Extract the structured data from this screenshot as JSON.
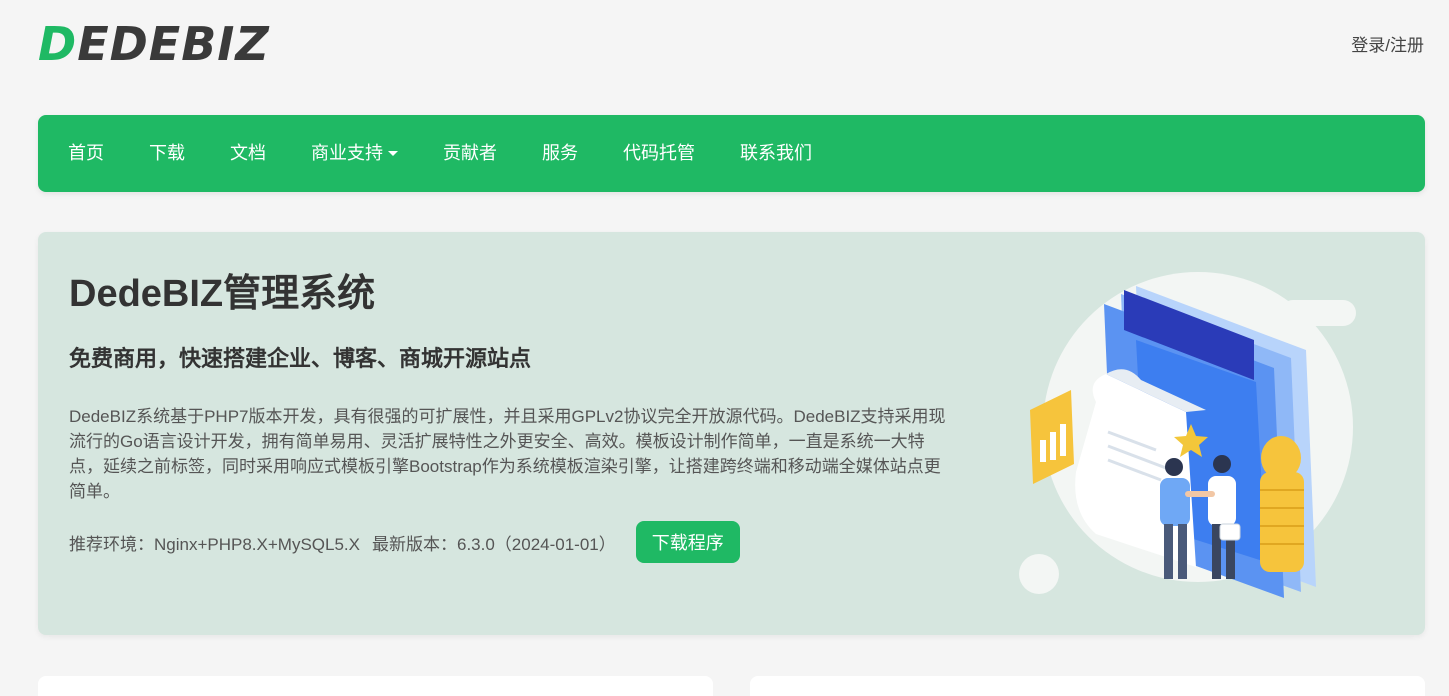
{
  "header": {
    "logo_first": "D",
    "logo_rest": "EDEBIZ",
    "login_label": "登录/注册"
  },
  "nav": {
    "items": [
      {
        "label": "首页"
      },
      {
        "label": "下载"
      },
      {
        "label": "文档"
      },
      {
        "label": "商业支持",
        "dropdown": true
      },
      {
        "label": "贡献者"
      },
      {
        "label": "服务"
      },
      {
        "label": "代码托管"
      },
      {
        "label": "联系我们"
      }
    ]
  },
  "hero": {
    "title": "DedeBIZ管理系统",
    "subtitle": "免费商用，快速搭建企业、博客、商城开源站点",
    "description": "DedeBIZ系统基于PHP7版本开发，具有很强的可扩展性，并且采用GPLv2协议完全开放源代码。DedeBIZ支持采用现流行的Go语言设计开发，拥有简单易用、灵活扩展特性之外更安全、高效。模板设计制作简单，一直是系统一大特点，延续之前标签，同时采用响应式模板引擎Bootstrap作为系统模板渲染引擎，让搭建跨终端和移动端全媒体站点更简单。",
    "env_text": "推荐环境：Nginx+PHP8.X+MySQL5.X",
    "version_text": "最新版本：6.3.0（2024-01-01）",
    "download_label": "下载程序"
  },
  "colors": {
    "brand": "#1fb964",
    "hero_bg": "#d6e6df",
    "page_bg": "#f5f5f5"
  }
}
